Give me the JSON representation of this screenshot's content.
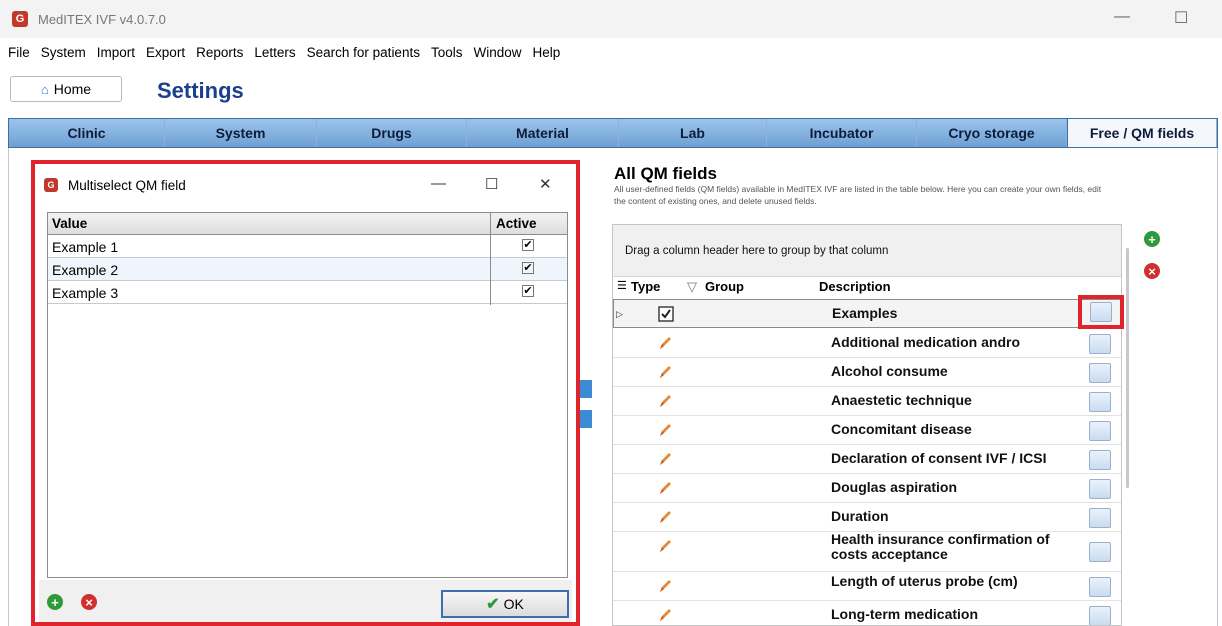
{
  "window": {
    "title": "MedITEX IVF v4.0.7.0",
    "minimize": "—",
    "maximize": "☐"
  },
  "menu": [
    "File",
    "System",
    "Import",
    "Export",
    "Reports",
    "Letters",
    "Search for patients",
    "Tools",
    "Window",
    "Help"
  ],
  "home_label": "Home",
  "page_title": "Settings",
  "tabs": [
    "Clinic",
    "System",
    "Drugs",
    "Material",
    "Lab",
    "Incubator",
    "Cryo storage",
    "Free / QM fields"
  ],
  "active_tab": "Free / QM fields",
  "background_left": {
    "heading_fragment": "I",
    "sub_fragment": "I"
  },
  "qm": {
    "title": "All QM fields",
    "description": "All user-defined fields (QM fields) available in MedITEX IVF are listed in the table below. Here you can create your own fields, edit the content of existing ones, and delete unused fields.",
    "group_hint": "Drag a column header here to group by that column",
    "columns": {
      "type": "Type",
      "group": "Group",
      "description": "Description"
    },
    "rows": [
      "Examples",
      "Additional medication andro",
      "Alcohol consume",
      "Anaestetic technique",
      "Concomitant disease",
      "Declaration of consent IVF / ICSI",
      "Douglas aspiration",
      "Duration",
      "Health insurance confirmation of costs acceptance",
      "Length of uterus probe (cm)",
      "Long-term medication"
    ]
  },
  "dialog": {
    "title": "Multiselect QM field",
    "minimize": "—",
    "maximize": "☐",
    "close": "✕",
    "columns": {
      "value": "Value",
      "active": "Active"
    },
    "rows": [
      {
        "value": "Example 1",
        "active": "✔"
      },
      {
        "value": "Example 2",
        "active": "✔"
      },
      {
        "value": "Example 3",
        "active": "✔"
      }
    ],
    "ok_label": "OK"
  },
  "colors": {
    "highlight": "#e0242c",
    "title_blue": "#1b3f8f",
    "tab_bar": "#6ea0d4"
  }
}
